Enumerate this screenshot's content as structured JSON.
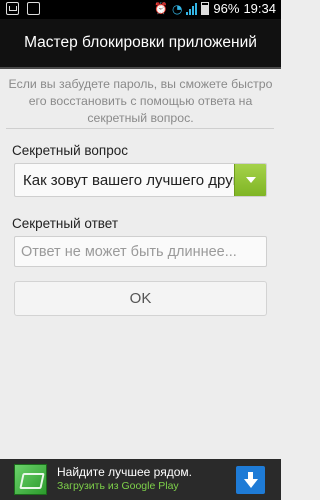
{
  "status_bar": {
    "battery_percent": "96%",
    "time": "19:34"
  },
  "header": {
    "title": "Мастер блокировки приложений"
  },
  "hint": "Если вы забудете пароль, вы сможете быстро его восстановить с помощью ответа на секретный вопрос.",
  "question": {
    "label": "Секретный вопрос",
    "selected": "Как зовут вашего лучшего друга?"
  },
  "answer": {
    "label": "Секретный ответ",
    "placeholder": "Ответ не может быть длиннее...",
    "value": ""
  },
  "ok_label": "OK",
  "ad": {
    "title": "Найдите лучшее рядом.",
    "subtitle": "Загрузить из Google Play"
  },
  "colors": {
    "accent_green": "#8cc43b",
    "ad_link": "#7ed14a",
    "download_blue": "#1e7bd6"
  },
  "icons": [
    "mail-icon",
    "clipboard-icon",
    "alarm-icon",
    "wifi-icon",
    "signal-icon",
    "battery-icon",
    "dropdown-arrow-icon",
    "app-icon",
    "download-icon"
  ]
}
